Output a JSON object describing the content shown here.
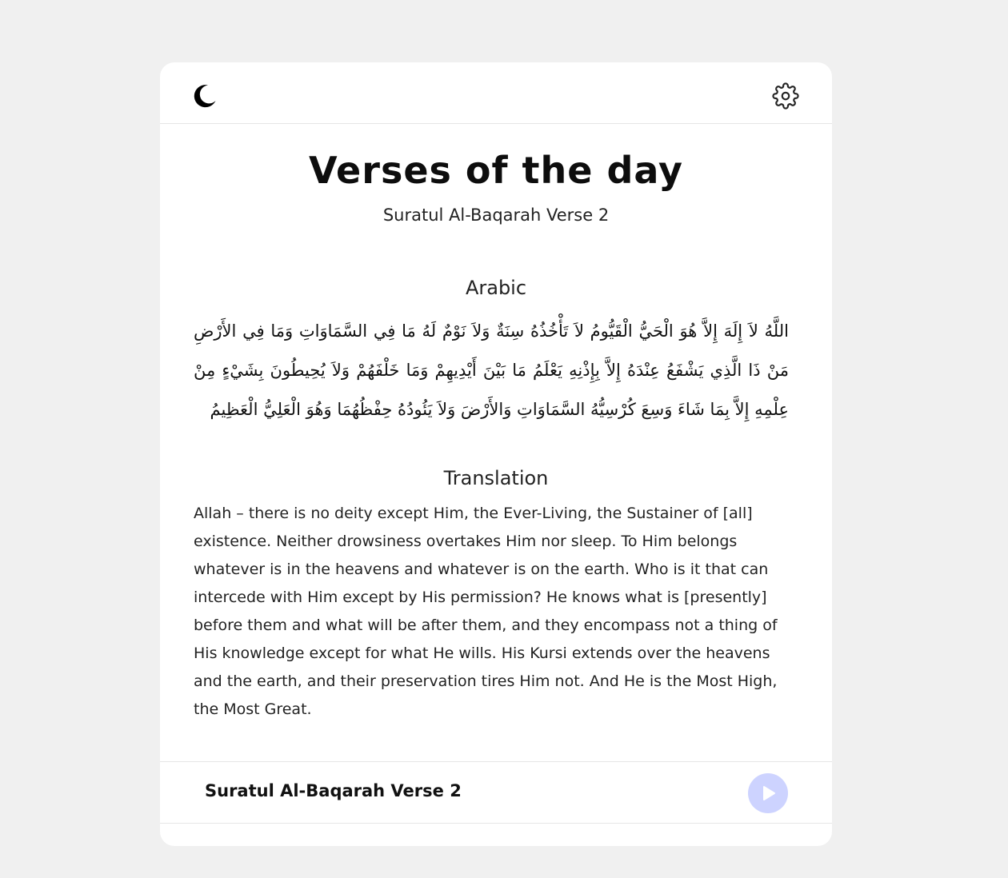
{
  "header": {
    "theme_toggle_icon": "moon-icon",
    "settings_icon": "gear-icon"
  },
  "main": {
    "title": "Verses of the day",
    "subtitle": "Suratul Al-Baqarah Verse 2",
    "arabic_heading": "Arabic",
    "arabic_text": "اللَّهُ لاَ إِلَهَ إِلاَّ هُوَ الْحَيُّ الْقَيُّومُ لاَ تَأْخُذُهُ سِنَةٌ وَلاَ نَوْمٌ لَهُ مَا فِي السَّمَاوَاتِ وَمَا فِي الأَرْضِ مَنْ ذَا الَّذِي يَشْفَعُ عِنْدَهُ إِلاَّ بِإِذْنِهِ يَعْلَمُ مَا بَيْنَ أَيْدِيهِمْ وَمَا خَلْفَهُمْ وَلاَ يُحِيطُونَ بِشَيْءٍ مِنْ عِلْمِهِ إِلاَّ بِمَا شَاءَ وَسِعَ كُرْسِيُّهُ السَّمَاوَاتِ وَالأَرْضَ وَلاَ يَئُودُهُ حِفْظُهُمَا وَهُوَ الْعَلِيُّ الْعَظِيمُ",
    "translation_heading": "Translation",
    "translation_text": "Allah – there is no deity except Him, the Ever-Living, the Sustainer of [all] existence. Neither drowsiness overtakes Him nor sleep. To Him belongs whatever is in the heavens and whatever is on the earth. Who is it that can intercede with Him except by His permission? He knows what is [presently] before them and what will be after them, and they encompass not a thing of His knowledge except for what He wills. His Kursi extends over the heavens and the earth, and their preservation tires Him not. And He is the Most High, the Most Great."
  },
  "player": {
    "label": "Suratul Al-Baqarah Verse 2",
    "play_icon": "play-icon",
    "accent_color": "#cdd3ff"
  }
}
